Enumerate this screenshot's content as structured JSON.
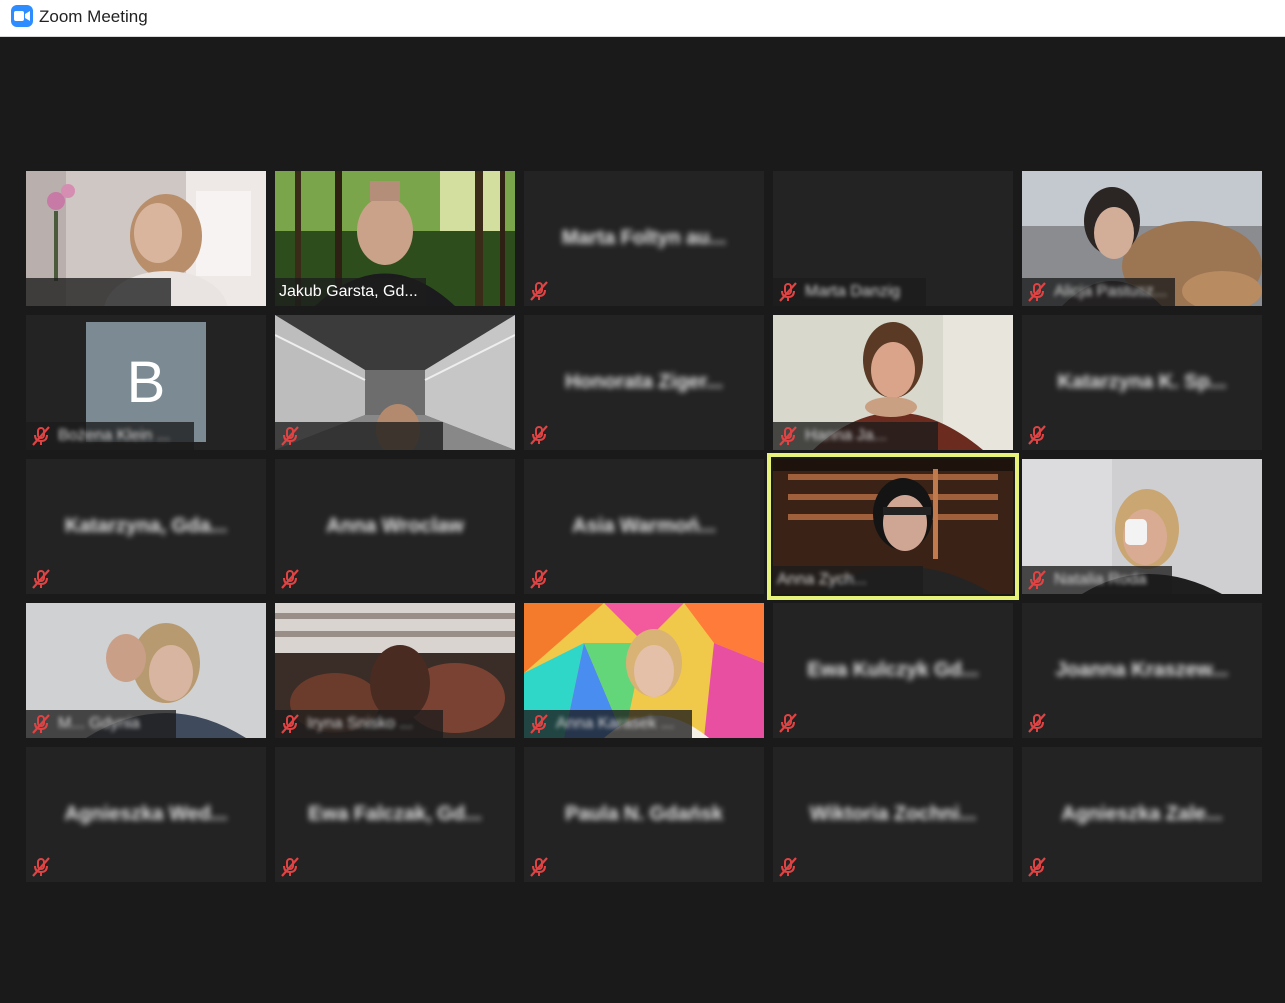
{
  "window": {
    "title": "Zoom Meeting",
    "icon": "zoom-camera-icon"
  },
  "colors": {
    "active_speaker_border": "#e6f27a",
    "mute_icon": "#e04343",
    "tile_bg": "#232323",
    "avatar_bg": "#7b8a93"
  },
  "participants": [
    {
      "name": "",
      "video": true,
      "muted": false,
      "name_blurred": true
    },
    {
      "name": "Jakub Garsta, Gd...",
      "video": true,
      "muted": false
    },
    {
      "name": "Marta Foltyn au...",
      "video": false,
      "muted": true,
      "name_blurred": true
    },
    {
      "name": "Marta Danzig",
      "video": false,
      "muted": true,
      "name_blurred": true
    },
    {
      "name": "Alicja Pastusz...",
      "video": true,
      "muted": true,
      "name_blurred": true
    },
    {
      "name": "Bożena Klein ...",
      "video": false,
      "muted": true,
      "avatar_letter": "B",
      "name_blurred": true
    },
    {
      "name": "",
      "video": true,
      "muted": true,
      "name_blurred": true
    },
    {
      "name": "Honorata Ziger...",
      "video": false,
      "muted": true,
      "name_blurred": true
    },
    {
      "name": "Hanna Ja...",
      "video": true,
      "muted": true,
      "name_blurred": true
    },
    {
      "name": "Katarzyna K. Sp...",
      "video": false,
      "muted": true,
      "name_blurred": true
    },
    {
      "name": "Katarzyna, Gda...",
      "video": false,
      "muted": true,
      "name_blurred": true
    },
    {
      "name": "Anna Wroclaw",
      "video": false,
      "muted": true,
      "name_blurred": true
    },
    {
      "name": "Asia Warmoń...",
      "video": false,
      "muted": true,
      "name_blurred": true
    },
    {
      "name": "Anna Zych...",
      "video": true,
      "muted": false,
      "active_speaker": true,
      "name_blurred": true
    },
    {
      "name": "Natalia Roda",
      "video": true,
      "muted": true,
      "name_blurred": true
    },
    {
      "name": "M... Gdynia",
      "video": true,
      "muted": true,
      "name_blurred": true
    },
    {
      "name": "Iryna Snisko ...",
      "video": true,
      "muted": true,
      "name_blurred": true
    },
    {
      "name": "Anna Karasek ...",
      "video": true,
      "muted": true,
      "name_blurred": true
    },
    {
      "name": "Ewa Kulczyk Gd...",
      "video": false,
      "muted": true,
      "name_blurred": true
    },
    {
      "name": "Joanna Kraszew...",
      "video": false,
      "muted": true,
      "name_blurred": true
    },
    {
      "name": "Agnieszka Wed...",
      "video": false,
      "muted": true,
      "name_blurred": true
    },
    {
      "name": "Ewa Falczak, Gd...",
      "video": false,
      "muted": true,
      "name_blurred": true
    },
    {
      "name": "Paula N. Gdańsk",
      "video": false,
      "muted": true,
      "name_blurred": true
    },
    {
      "name": "Wiktoria Zochni...",
      "video": false,
      "muted": true,
      "name_blurred": true
    },
    {
      "name": "Agnieszka Zale...",
      "video": false,
      "muted": true,
      "name_blurred": true
    }
  ]
}
